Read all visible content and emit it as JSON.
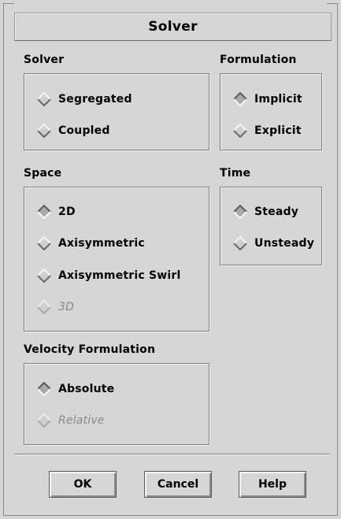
{
  "window": {
    "title": "Solver"
  },
  "solver": {
    "label": "Solver",
    "options": [
      {
        "label": "Segregated",
        "selected": false,
        "enabled": true
      },
      {
        "label": "Coupled",
        "selected": false,
        "enabled": true
      }
    ]
  },
  "formulation": {
    "label": "Formulation",
    "options": [
      {
        "label": "Implicit",
        "selected": true,
        "enabled": true
      },
      {
        "label": "Explicit",
        "selected": false,
        "enabled": true
      }
    ]
  },
  "space": {
    "label": "Space",
    "options": [
      {
        "label": "2D",
        "selected": true,
        "enabled": true
      },
      {
        "label": "Axisymmetric",
        "selected": false,
        "enabled": true
      },
      {
        "label": "Axisymmetric Swirl",
        "selected": false,
        "enabled": true
      },
      {
        "label": "3D",
        "selected": false,
        "enabled": false
      }
    ]
  },
  "time": {
    "label": "Time",
    "options": [
      {
        "label": "Steady",
        "selected": true,
        "enabled": true
      },
      {
        "label": "Unsteady",
        "selected": false,
        "enabled": true
      }
    ]
  },
  "velocity_formulation": {
    "label": "Velocity Formulation",
    "options": [
      {
        "label": "Absolute",
        "selected": true,
        "enabled": true
      },
      {
        "label": "Relative",
        "selected": false,
        "enabled": false
      }
    ]
  },
  "buttons": {
    "ok": "OK",
    "cancel": "Cancel",
    "help": "Help"
  },
  "colors": {
    "background": "#d6d6d6",
    "border_dark": "#7d7d7d",
    "border_light": "#f4f4f4",
    "disabled_text": "#8a8a8a"
  },
  "icons": {
    "radio": "diamond-radio-icon"
  }
}
